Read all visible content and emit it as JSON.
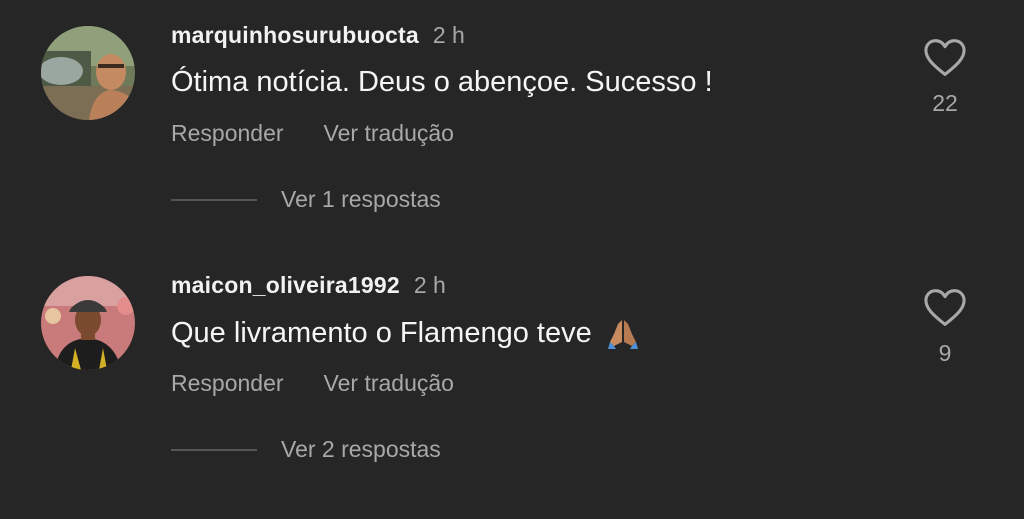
{
  "comments": [
    {
      "username": "marquinhosurubuocta",
      "time": "2 h",
      "text": "Ótima notícia.  Deus o abençoe.  Sucesso !",
      "reply_label": "Responder",
      "translate_label": "Ver tradução",
      "view_replies_label": "Ver 1 respostas",
      "likes": "22",
      "icon": "heart-outline-icon"
    },
    {
      "username": "maicon_oliveira1992",
      "time": "2 h",
      "text": "Que livramento o Flamengo teve",
      "emoji": "folded-hands",
      "reply_label": "Responder",
      "translate_label": "Ver tradução",
      "view_replies_label": "Ver 2 respostas",
      "likes": "9",
      "icon": "heart-outline-icon"
    }
  ],
  "colors": {
    "background": "#262626",
    "primary_text": "#f5f5f5",
    "secondary_text": "#a8a8a8"
  }
}
